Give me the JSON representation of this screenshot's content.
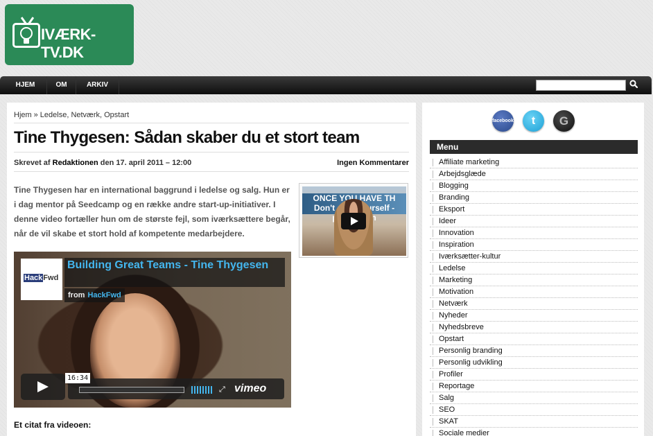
{
  "site": {
    "logo_text": "IVÆRK-TV.DK"
  },
  "nav": {
    "items": [
      "HJEM",
      "OM",
      "ARKIV"
    ]
  },
  "search": {
    "value": ""
  },
  "breadcrumb": {
    "home": "Hjem",
    "separator": "»",
    "categories": "Ledelse, Netværk, Opstart"
  },
  "post": {
    "title": "Tine Thygesen: Sådan skaber du et stort team",
    "meta_prefix": "Skrevet af",
    "author": "Redaktionen",
    "meta_date": "den 17. april 2011 – 12:00",
    "comments": "Ingen Kommentarer",
    "intro": "Tine Thygesen har en international baggrund i ledelse og salg. Hun er i dag mentor på Seedcamp og en række andre start-up-initiativer. I denne video fortæller hun om de største fejl, som iværksættere begår, når de vil skabe et stort hold af kompetente medarbejdere.",
    "quote_heading": "Et citat fra videoen:"
  },
  "thumbnail": {
    "banner_text": "ONCE YOU HAVE TH Don't do it yourself - people join"
  },
  "video": {
    "logo_hack": "Hack",
    "logo_fwd": "Fwd",
    "title": "Building Great Teams - Tine Thygesen",
    "from_label": "from",
    "from_link": "HackFwd",
    "duration": "16:34",
    "brand": "vimeo",
    "progress": 0
  },
  "social": {
    "facebook": "facebook",
    "twitter": "t",
    "google": "G"
  },
  "menu": {
    "title": "Menu",
    "items": [
      "Affiliate marketing",
      "Arbejdsglæde",
      "Blogging",
      "Branding",
      "Eksport",
      "Ideer",
      "Innovation",
      "Inspiration",
      "Iværksætter-kultur",
      "Ledelse",
      "Marketing",
      "Motivation",
      "Netværk",
      "Nyheder",
      "Nyhedsbreve",
      "Opstart",
      "Personlig branding",
      "Personlig udvikling",
      "Profiler",
      "Reportage",
      "Salg",
      "SEO",
      "SKAT",
      "Sociale medier"
    ]
  }
}
